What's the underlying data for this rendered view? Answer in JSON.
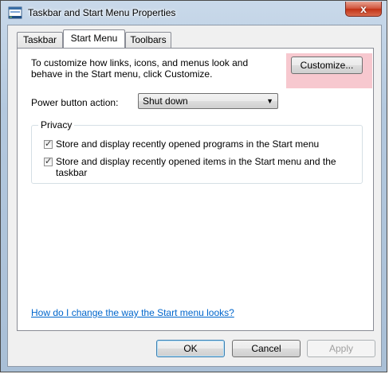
{
  "window": {
    "title": "Taskbar and Start Menu Properties",
    "close_glyph": "x"
  },
  "tabs": [
    {
      "label": "Taskbar"
    },
    {
      "label": "Start Menu"
    },
    {
      "label": "Toolbars"
    }
  ],
  "start_menu": {
    "description": "To customize how links, icons, and menus look and behave in the Start menu, click Customize.",
    "customize_label": "Customize...",
    "power_button_label": "Power button action:",
    "power_button_value": "Shut down",
    "privacy_label": "Privacy",
    "privacy_items": [
      {
        "label": "Store and display recently opened programs in the Start menu",
        "checked": true
      },
      {
        "label": "Store and display recently opened items in the Start menu and the taskbar",
        "checked": true
      }
    ],
    "help_link": "How do I change the way the Start menu looks?"
  },
  "footer": {
    "ok_label": "OK",
    "cancel_label": "Cancel",
    "apply_label": "Apply"
  },
  "icons": {
    "window_icon": "taskbar-properties-icon",
    "checkmark": "checkmark-icon",
    "dropdown": "chevron-down-icon"
  },
  "colors": {
    "highlight": "#f7c8cf",
    "link": "#0066cc",
    "close_button": "#c23216"
  }
}
